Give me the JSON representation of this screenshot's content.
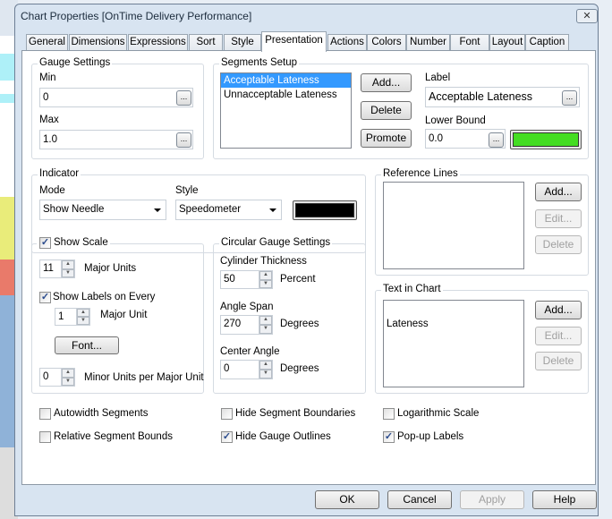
{
  "window": {
    "title": "Chart Properties [OnTime Delivery Performance]",
    "close_label": "✕"
  },
  "tabs": [
    "General",
    "Dimensions",
    "Expressions",
    "Sort",
    "Style",
    "Presentation",
    "Actions",
    "Colors",
    "Number",
    "Font",
    "Layout",
    "Caption"
  ],
  "selected_tab": "Presentation",
  "gauge_settings": {
    "title": "Gauge Settings",
    "min_label": "Min",
    "min_value": "0",
    "max_label": "Max",
    "max_value": "1.0",
    "dots": "..."
  },
  "segments": {
    "title": "Segments Setup",
    "items": [
      "Acceptable Lateness",
      "Unnacceptable Lateness"
    ],
    "selected": "Acceptable Lateness",
    "add": "Add...",
    "delete": "Delete",
    "promote": "Promote",
    "label_label": "Label",
    "label_value": "Acceptable Lateness",
    "lower_bound_label": "Lower Bound",
    "lower_bound_value": "0.0",
    "color": "#44dd22"
  },
  "indicator": {
    "title": "Indicator",
    "mode_label": "Mode",
    "mode_value": "Show Needle",
    "style_label": "Style",
    "style_value": "Speedometer",
    "color": "#000000"
  },
  "reference_lines": {
    "title": "Reference Lines",
    "add": "Add...",
    "edit": "Edit...",
    "delete": "Delete"
  },
  "show_scale": {
    "title": "Show Scale",
    "checked": true,
    "major_units": "11",
    "major_units_label": "Major Units",
    "show_labels": "Show Labels on Every",
    "show_labels_checked": true,
    "label_every": "1",
    "major_unit_label": "Major Unit",
    "font": "Font...",
    "minor_units": "0",
    "minor_units_label": "Minor Units per Major Unit"
  },
  "circular": {
    "title": "Circular Gauge Settings",
    "thickness_label": "Cylinder Thickness",
    "thickness": "50",
    "percent": "Percent",
    "span_label": "Angle Span",
    "span": "270",
    "degrees": "Degrees",
    "center_label": "Center Angle",
    "center": "0"
  },
  "text_in_chart": {
    "title": "Text in Chart",
    "items": [
      "Lateness"
    ],
    "add": "Add...",
    "edit": "Edit...",
    "delete": "Delete"
  },
  "options": [
    {
      "label": "Autowidth Segments",
      "checked": false
    },
    {
      "label": "Hide Segment Boundaries",
      "checked": false
    },
    {
      "label": "Logarithmic Scale",
      "checked": false
    },
    {
      "label": "Relative Segment Bounds",
      "checked": false
    },
    {
      "label": "Hide Gauge Outlines",
      "checked": true
    },
    {
      "label": "Pop-up Labels",
      "checked": true
    }
  ],
  "footer": {
    "ok": "OK",
    "cancel": "Cancel",
    "apply": "Apply",
    "help": "Help"
  },
  "check_glyph": "✓"
}
